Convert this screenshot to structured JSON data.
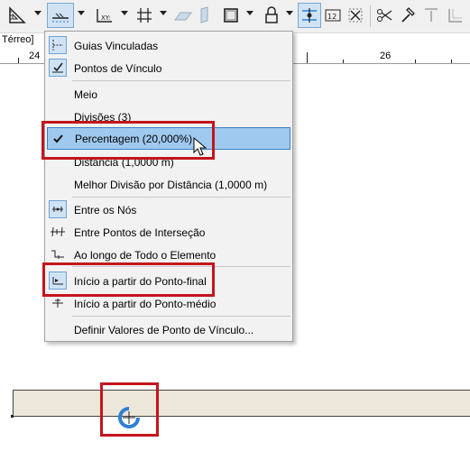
{
  "toolbar": {
    "buttons": [
      {
        "icon": "ruler-triangle-icon"
      },
      {
        "icon": "guide-line-icon",
        "pressed": true
      },
      {
        "icon": "xy-coordinate-icon"
      },
      {
        "icon": "grid-snap-icon"
      },
      {
        "icon": "parallel-plane-icon"
      },
      {
        "icon": "vertical-plane-icon"
      },
      {
        "icon": "square-snap-icon"
      },
      {
        "icon": "lock-icon"
      },
      {
        "icon": "smart-snap-icon",
        "pressed": true
      },
      {
        "icon": "dimension-icon"
      },
      {
        "icon": "cross-point-icon"
      },
      {
        "icon": "scissors-icon"
      },
      {
        "icon": "hammer-icon"
      },
      {
        "icon": "trim-top-icon"
      },
      {
        "icon": "trim-corner-icon"
      }
    ]
  },
  "floor_tab": "Térreo]",
  "ruler": {
    "left_number": "24",
    "right_number": "26"
  },
  "menu": {
    "items": [
      {
        "label": "Guias Vinculadas",
        "icon": "linked-guides-icon",
        "checked": true
      },
      {
        "label": "Pontos de Vínculo",
        "icon": "snap-points-icon",
        "checked": true
      },
      {
        "label": "Meio",
        "icon": "",
        "checked": false
      },
      {
        "label": "Divisões (3)",
        "icon": "",
        "checked": false
      },
      {
        "label": "Percentagem (20,000%)",
        "icon": "checkmark-icon",
        "checked": false,
        "highlighted": true
      },
      {
        "label": "Distância (1,0000 m)",
        "icon": "",
        "checked": false
      },
      {
        "label": "Melhor Divisão por Distância (1,0000 m)",
        "icon": "",
        "checked": false
      },
      {
        "label": "Entre os Nós",
        "icon": "between-nodes-icon",
        "checked": true
      },
      {
        "label": "Entre Pontos de Interseção",
        "icon": "between-intersections-icon",
        "checked": false
      },
      {
        "label": "Ao longo de Todo o Elemento",
        "icon": "along-element-icon",
        "checked": false
      },
      {
        "label": "Início a partir do Ponto-final",
        "icon": "from-endpoint-icon",
        "checked": true
      },
      {
        "label": "Início a partir do Ponto-médio",
        "icon": "from-midpoint-icon",
        "checked": false
      },
      {
        "label": "Definir Valores de Ponto de Vínculo...",
        "icon": "",
        "checked": false
      }
    ]
  },
  "colors": {
    "callout": "#c4151c",
    "highlight": "#9fc9ef",
    "snap_marker": "#2f7fd6",
    "wall": "#ece7d8"
  }
}
